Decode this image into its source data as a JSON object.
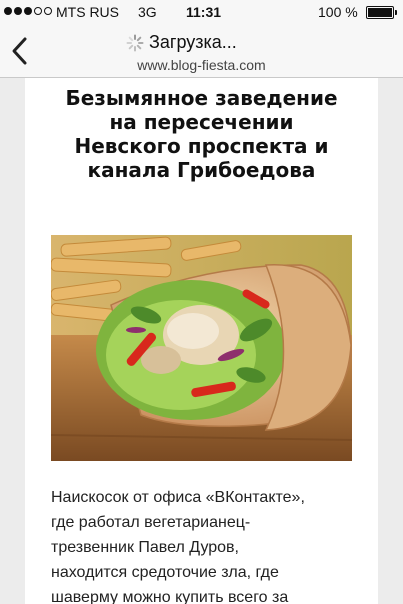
{
  "status_bar": {
    "carrier": "MTS RUS",
    "network": "3G",
    "time": "11:31",
    "battery": "100 %",
    "signal_bars_filled": 3,
    "signal_bars_total": 5
  },
  "nav": {
    "title": "Загрузка...",
    "url": "www.blog-fiesta.com"
  },
  "article": {
    "title": "Безымянное заведение\nна пересечении\nНевского проспекта и\nканала Грибоедова",
    "body": "Наискосок от офиса «ВКонтакте»,\nгде работал вегетарианец-\nтрезвенник Павел Дуров,\nнаходится средоточие зла, где\nшаверму можно купить всего за"
  },
  "icons": {
    "back": "chevron-left-icon",
    "loading": "spinner-icon",
    "battery": "battery-icon"
  },
  "colors": {
    "bar_background": "#f7f7f7",
    "page_background": "#ececec",
    "article_background": "#ffffff"
  }
}
